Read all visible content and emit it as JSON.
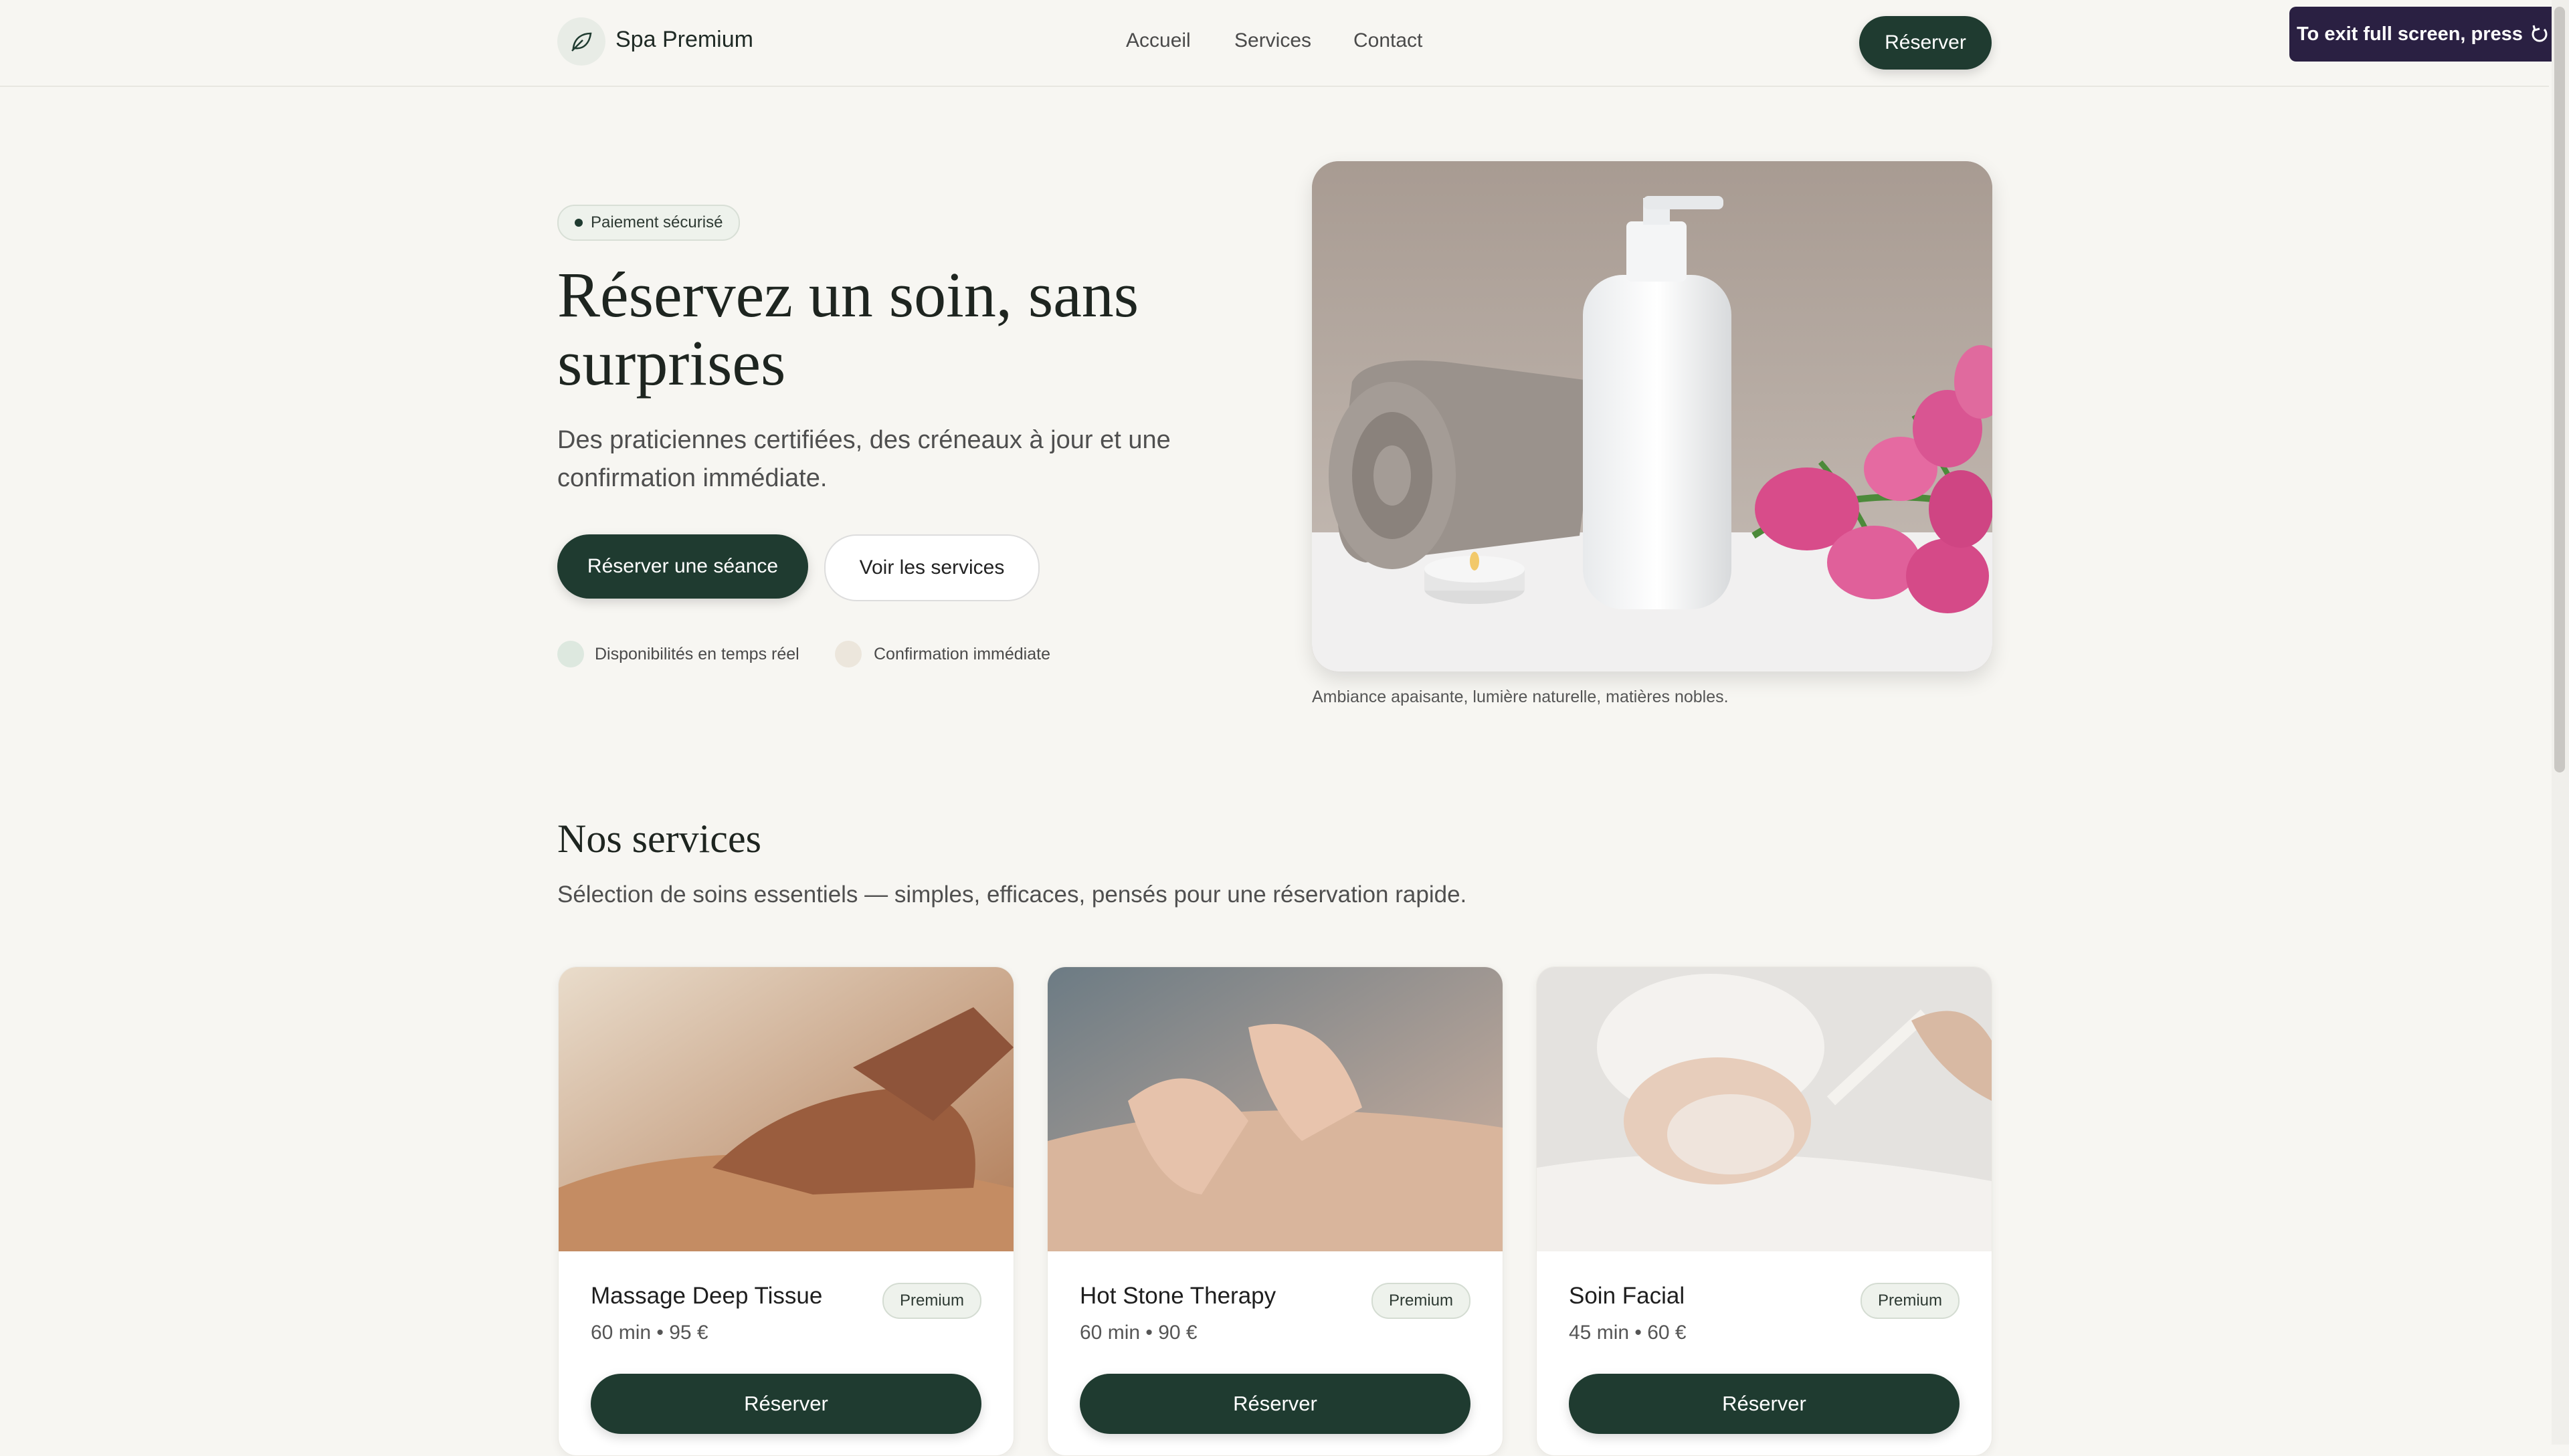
{
  "header": {
    "brand": "Spa Premium",
    "nav": [
      "Accueil",
      "Services",
      "Contact"
    ],
    "cta": "Réserver",
    "fullscreen_notice": "To exit full screen, press"
  },
  "hero": {
    "badge": "Paiement sécurisé",
    "title": "Réservez un soin, sans surprises",
    "subtitle": "Des praticiennes certifiées, des créneaux à jour et une confirmation immédiate.",
    "primary_cta": "Réserver une séance",
    "secondary_cta": "Voir les services",
    "features": [
      "Disponibilités en temps réel",
      "Confirmation immédiate"
    ],
    "image_caption": "Ambiance apaisante, lumière naturelle, matières nobles."
  },
  "services": {
    "title": "Nos services",
    "subtitle": "Sélection de soins essentiels — simples, efficaces, pensés pour une réservation rapide.",
    "items": [
      {
        "name": "Massage Deep Tissue",
        "tag": "Premium",
        "meta": "60 min • 95 €",
        "cta": "Réserver"
      },
      {
        "name": "Hot Stone Therapy",
        "tag": "Premium",
        "meta": "60 min • 90 €",
        "cta": "Réserver"
      },
      {
        "name": "Soin Facial",
        "tag": "Premium",
        "meta": "45 min • 60 €",
        "cta": "Réserver"
      }
    ]
  },
  "colors": {
    "background": "#f7f6f2",
    "accent": "#1f3b30",
    "badge_bg": "#eef2ec",
    "tooltip_bg": "#2a2042"
  },
  "icons": {
    "logo": "leaf-icon",
    "fullscreen_exit": "exit-fullscreen-icon"
  }
}
